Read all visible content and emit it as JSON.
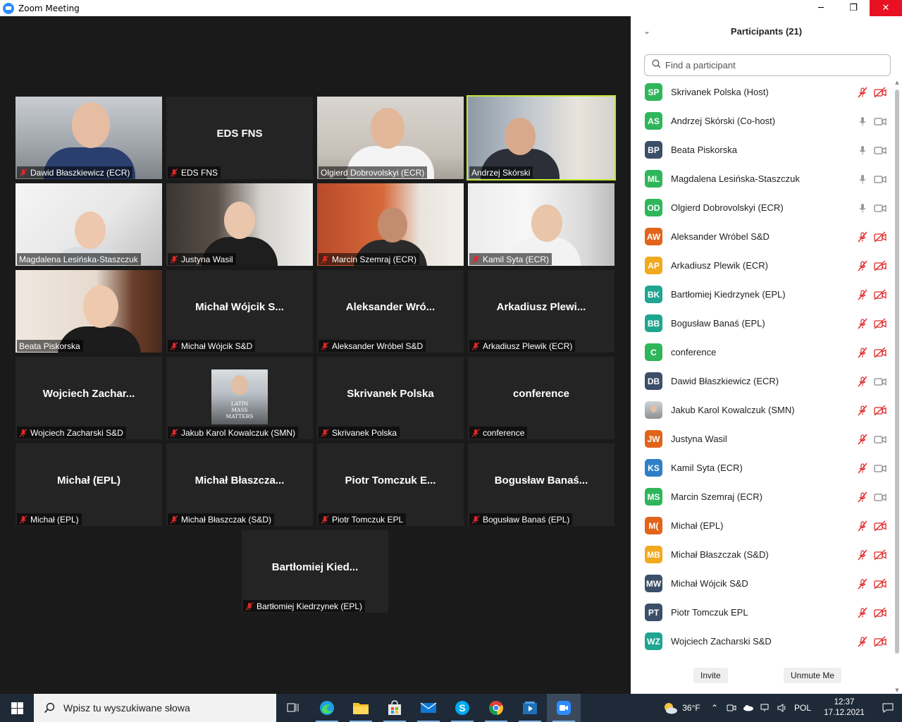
{
  "window": {
    "title": "Zoom Meeting",
    "minimize": "─",
    "maximize": "❐",
    "close": "✕"
  },
  "gallery": {
    "tiles": [
      {
        "label": "Dawid Błaszkiewicz (ECR)",
        "center": "",
        "video": true,
        "muted": true
      },
      {
        "label": "EDS FNS",
        "center": "EDS FNS",
        "video": false,
        "muted": true
      },
      {
        "label": "Olgierd Dobrovolskyi (ECR)",
        "center": "",
        "video": true,
        "muted": false
      },
      {
        "label": "Andrzej Skórski",
        "center": "",
        "video": true,
        "muted": false,
        "active": true
      },
      {
        "label": "Magdalena Lesińska-Staszczuk",
        "center": "",
        "video": true,
        "muted": false
      },
      {
        "label": "Justyna Wasil",
        "center": "",
        "video": true,
        "muted": true
      },
      {
        "label": "Marcin Szemraj (ECR)",
        "center": "",
        "video": true,
        "muted": true
      },
      {
        "label": "Kamil Syta (ECR)",
        "center": "",
        "video": true,
        "muted": true
      },
      {
        "label": "Beata Piskorska",
        "center": "",
        "video": true,
        "muted": false
      },
      {
        "label": "Michał Wójcik S&D",
        "center": "Michał  Wójcik  S...",
        "video": false,
        "muted": true
      },
      {
        "label": "Aleksander Wróbel S&D",
        "center": "Aleksander  Wró...",
        "video": false,
        "muted": true
      },
      {
        "label": "Arkadiusz Plewik (ECR)",
        "center": "Arkadiusz  Plewi...",
        "video": false,
        "muted": true
      },
      {
        "label": "Wojciech Zacharski S&D",
        "center": "Wojciech  Zachar...",
        "video": false,
        "muted": true
      },
      {
        "label": "Jakub Karol Kowalczuk (SMN)",
        "center": "",
        "video": false,
        "muted": true,
        "thumb_text": [
          "LATIN",
          "MASS",
          "MATTERS"
        ]
      },
      {
        "label": "Skrivanek Polska",
        "center": "Skrivanek Polska",
        "video": false,
        "muted": true
      },
      {
        "label": "conference",
        "center": "conference",
        "video": false,
        "muted": true
      },
      {
        "label": "Michał (EPL)",
        "center": "Michał (EPL)",
        "video": false,
        "muted": true
      },
      {
        "label": "Michał Błaszczak (S&D)",
        "center": "Michał  Błaszcza...",
        "video": false,
        "muted": true
      },
      {
        "label": "Piotr Tomczuk EPL",
        "center": "Piotr  Tomczuk  E...",
        "video": false,
        "muted": true
      },
      {
        "label": "Bogusław Banaś (EPL)",
        "center": "Bogusław  Banaś...",
        "video": false,
        "muted": true
      },
      {
        "label": "Bartłomiej Kiedrzynek (EPL)",
        "center": "Bartłomiej  Kied...",
        "video": false,
        "muted": true
      }
    ]
  },
  "participants": {
    "title": "Participants (21)",
    "search_placeholder": "Find a participant",
    "list": [
      {
        "initials": "SP",
        "name": "Skrivanek Polska (Host)",
        "color": "#2fb65b",
        "mic": "muted",
        "cam": "off"
      },
      {
        "initials": "AS",
        "name": "Andrzej Skórski (Co-host)",
        "color": "#2fb65b",
        "mic": "on",
        "cam": "on"
      },
      {
        "initials": "BP",
        "name": "Beata Piskorska",
        "color": "#3c4f69",
        "mic": "on",
        "cam": "on"
      },
      {
        "initials": "ML",
        "name": "Magdalena Lesińska-Staszczuk",
        "color": "#2fb65b",
        "mic": "on",
        "cam": "on"
      },
      {
        "initials": "OD",
        "name": "Olgierd Dobrovolskyi (ECR)",
        "color": "#2fb65b",
        "mic": "on",
        "cam": "on"
      },
      {
        "initials": "AW",
        "name": "Aleksander Wróbel S&D",
        "color": "#e0641a",
        "mic": "muted",
        "cam": "off"
      },
      {
        "initials": "AP",
        "name": "Arkadiusz Plewik (ECR)",
        "color": "#f2a91e",
        "mic": "muted",
        "cam": "off"
      },
      {
        "initials": "BK",
        "name": "Bartłomiej Kiedrzynek (EPL)",
        "color": "#1fa590",
        "mic": "muted",
        "cam": "off"
      },
      {
        "initials": "BB",
        "name": "Bogusław Banaś (EPL)",
        "color": "#1fa590",
        "mic": "muted",
        "cam": "off"
      },
      {
        "initials": "C",
        "name": "conference",
        "color": "#2fb65b",
        "mic": "muted",
        "cam": "off"
      },
      {
        "initials": "DB",
        "name": "Dawid Błaszkiewicz (ECR)",
        "color": "#3c4f69",
        "mic": "muted",
        "cam": "on"
      },
      {
        "initials": "",
        "name": "Jakub Karol Kowalczuk (SMN)",
        "color": "#8a8f94",
        "mic": "muted",
        "cam": "off",
        "photo": true
      },
      {
        "initials": "JW",
        "name": "Justyna Wasil",
        "color": "#e0641a",
        "mic": "muted",
        "cam": "on"
      },
      {
        "initials": "KS",
        "name": "Kamil Syta (ECR)",
        "color": "#2e7fc7",
        "mic": "muted",
        "cam": "on"
      },
      {
        "initials": "MS",
        "name": "Marcin Szemraj (ECR)",
        "color": "#2fb65b",
        "mic": "muted",
        "cam": "on"
      },
      {
        "initials": "M(",
        "name": "Michał (EPL)",
        "color": "#e0641a",
        "mic": "muted",
        "cam": "off"
      },
      {
        "initials": "MB",
        "name": "Michał Błaszczak (S&D)",
        "color": "#f2a91e",
        "mic": "muted",
        "cam": "off"
      },
      {
        "initials": "MW",
        "name": "Michał Wójcik S&D",
        "color": "#3c4f69",
        "mic": "muted",
        "cam": "off"
      },
      {
        "initials": "PT",
        "name": "Piotr Tomczuk EPL",
        "color": "#3c4f69",
        "mic": "muted",
        "cam": "off"
      },
      {
        "initials": "WZ",
        "name": "Wojciech Zacharski S&D",
        "color": "#1fa590",
        "mic": "muted",
        "cam": "off"
      }
    ],
    "invite_label": "Invite",
    "unmute_label": "Unmute Me"
  },
  "taskbar": {
    "search_placeholder": "Wpisz tu wyszukiwane słowa",
    "apps": [
      "task-view-icon",
      "edge-icon",
      "file-explorer-icon",
      "store-icon",
      "mail-icon",
      "skype-icon",
      "chrome-icon",
      "media-player-icon",
      "zoom-icon"
    ],
    "weather": "36°F",
    "language": "POL",
    "time": "12:37",
    "date": "17.12.2021"
  },
  "colors": {
    "accent": "#2d8cff",
    "active_speaker": "#c2e63c",
    "muted_red": "#e02828"
  }
}
